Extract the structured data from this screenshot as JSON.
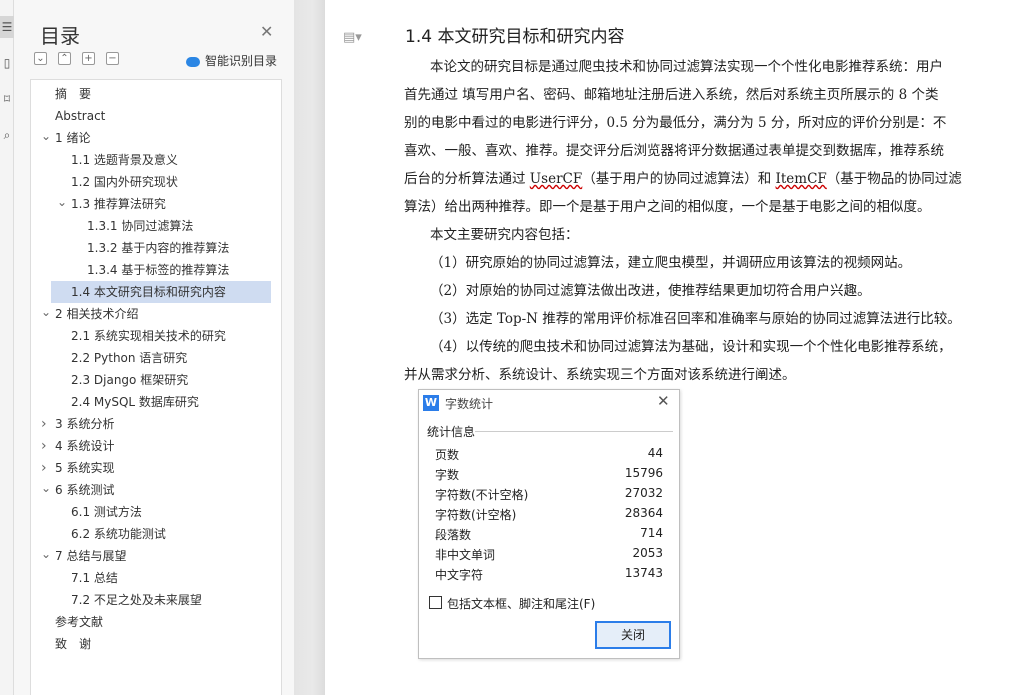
{
  "strip_icons": [
    "menu-icon",
    "page-icon",
    "bookmark-icon",
    "search-icon"
  ],
  "toc": {
    "title": "目录",
    "smart_label": "智能识别目录",
    "items": [
      {
        "label": "摘　要"
      },
      {
        "label": "Abstract"
      },
      {
        "label": "1 绪论",
        "expanded": true
      },
      {
        "label": "1.1 选题背景及意义"
      },
      {
        "label": "1.2 国内外研究现状"
      },
      {
        "label": "1.3 推荐算法研究",
        "expanded": true
      },
      {
        "label": "1.3.1 协同过滤算法"
      },
      {
        "label": "1.3.2 基于内容的推荐算法"
      },
      {
        "label": "1.3.4 基于标签的推荐算法"
      },
      {
        "label": "1.4 本文研究目标和研究内容",
        "selected": true
      },
      {
        "label": "2 相关技术介绍",
        "expanded": true
      },
      {
        "label": "2.1 系统实现相关技术的研究"
      },
      {
        "label": "2.2 Python 语言研究"
      },
      {
        "label": "2.3 Django 框架研究"
      },
      {
        "label": "2.4 MySQL 数据库研究"
      },
      {
        "label": "3 系统分析",
        "expanded": false
      },
      {
        "label": "4 系统设计",
        "expanded": false
      },
      {
        "label": "5 系统实现",
        "expanded": false
      },
      {
        "label": "6 系统测试",
        "expanded": true
      },
      {
        "label": "6.1 测试方法"
      },
      {
        "label": "6.2 系统功能测试"
      },
      {
        "label": "7 总结与展望",
        "expanded": true
      },
      {
        "label": "7.1 总结"
      },
      {
        "label": "7.2 不足之处及未来展望"
      },
      {
        "label": "参考文献"
      },
      {
        "label": "致　谢"
      }
    ]
  },
  "document": {
    "heading": "1.4 本文研究目标和研究内容",
    "lines": [
      "本论文的研究目标是通过爬虫技术和协同过滤算法实现一个个性化电影推荐系统：用户",
      "首先通过 填写用户名、密码、邮箱地址注册后进入系统，然后对系统主页所展示的 8 个类",
      "别的电影中看过的电影进行评分，0.5 分为最低分，满分为 5 分，所对应的评价分别是：不",
      "喜欢、一般、喜欢、推荐。提交评分后浏览器将评分数据通过表单提交到数据库，推荐系统",
      "后台的分析算法通过 UserCF（基于用户的协同过滤算法）和 ItemCF（基于物品的协同过滤",
      "算法）给出两种推荐。即一个是基于用户之间的相似度，一个是基于电影之间的相似度。",
      "本文主要研究内容包括：",
      "（1）研究原始的协同过滤算法，建立爬虫模型，并调研应用该算法的视频网站。",
      "（2）对原始的协同过滤算法做出改进，使推荐结果更加切符合用户兴趣。",
      "（3）选定 Top-N 推荐的常用评价标准召回率和准确率与原始的协同过滤算法进行比较。",
      "（4）以传统的爬虫技术和协同过滤算法为基础，设计和实现一个个性化电影推荐系统，",
      "并从需求分析、系统设计、系统实现三个方面对该系统进行阐述。"
    ]
  },
  "dialog": {
    "title": "字数统计",
    "section": "统计信息",
    "stats": [
      {
        "label": "页数",
        "value": "44"
      },
      {
        "label": "字数",
        "value": "15796"
      },
      {
        "label": "字符数(不计空格)",
        "value": "27032"
      },
      {
        "label": "字符数(计空格)",
        "value": "28364"
      },
      {
        "label": "段落数",
        "value": "714"
      },
      {
        "label": "非中文单词",
        "value": "2053"
      },
      {
        "label": "中文字符",
        "value": "13743"
      }
    ],
    "checkbox_label": "包括文本框、脚注和尾注(F)",
    "checkbox_checked": false,
    "close_label": "关闭"
  }
}
